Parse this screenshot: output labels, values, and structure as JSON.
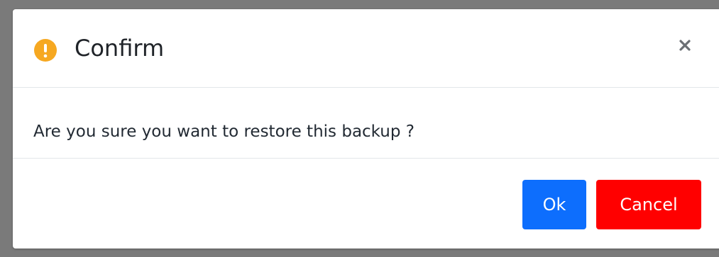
{
  "dialog": {
    "title": "Confirm",
    "icon": "warning-icon",
    "message": "Are you sure you want to restore this backup ?",
    "buttons": {
      "ok_label": "Ok",
      "cancel_label": "Cancel"
    },
    "close_icon": "close-icon"
  },
  "colors": {
    "warning": "#f6a821",
    "ok_button": "#0d6efd",
    "cancel_button": "#ff0000",
    "backdrop": "#7a7a7a"
  }
}
